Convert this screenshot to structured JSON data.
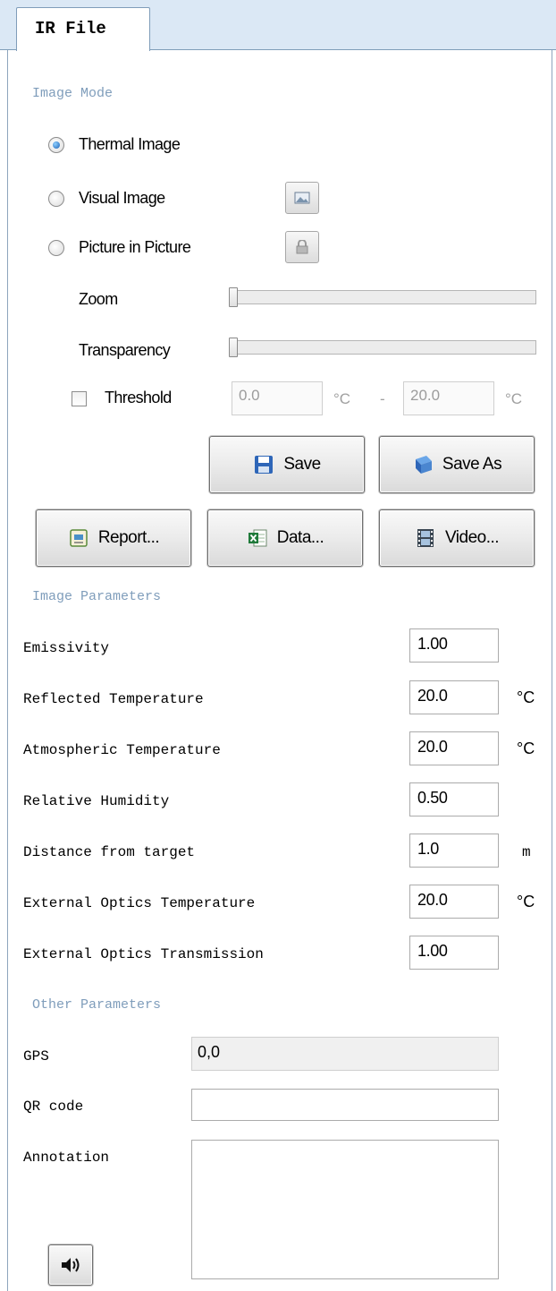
{
  "tab": {
    "title": "IR File"
  },
  "image_mode": {
    "section_label": "Image Mode",
    "options": [
      {
        "label": "Thermal Image",
        "selected": true
      },
      {
        "label": "Visual Image",
        "selected": false,
        "icon": "image-icon"
      },
      {
        "label": "Picture in Picture",
        "selected": false,
        "icon": "lock-icon"
      }
    ],
    "zoom_label": "Zoom",
    "zoom_value": 0,
    "transparency_label": "Transparency",
    "transparency_value": 0,
    "threshold": {
      "label": "Threshold",
      "checked": false,
      "min": "0.0",
      "max": "20.0",
      "unit": "°C",
      "separator": "-"
    }
  },
  "buttons": {
    "save": "Save",
    "save_as": "Save As",
    "report": "Report...",
    "data": "Data...",
    "video": "Video..."
  },
  "image_parameters": {
    "section_label": "Image Parameters",
    "rows": [
      {
        "label": "Emissivity",
        "value": "1.00",
        "unit": ""
      },
      {
        "label": "Reflected Temperature",
        "value": "20.0",
        "unit": "°C"
      },
      {
        "label": "Atmospheric Temperature",
        "value": "20.0",
        "unit": "°C"
      },
      {
        "label": "Relative Humidity",
        "value": "0.50",
        "unit": ""
      },
      {
        "label": "Distance from target",
        "value": "1.0",
        "unit": "m"
      },
      {
        "label": "External Optics Temperature",
        "value": "20.0",
        "unit": "°C"
      },
      {
        "label": "External Optics Transmission",
        "value": "1.00",
        "unit": ""
      }
    ]
  },
  "other_parameters": {
    "section_label": "Other Parameters",
    "gps_label": "GPS",
    "gps_value": "0,0",
    "qr_label": "QR code",
    "qr_value": "",
    "annotation_label": "Annotation",
    "annotation_value": ""
  },
  "colors": {
    "section_text": "#7f9dbb",
    "tab_strip": "#dbe8f5",
    "radio_selected": "#1a5fb4"
  }
}
